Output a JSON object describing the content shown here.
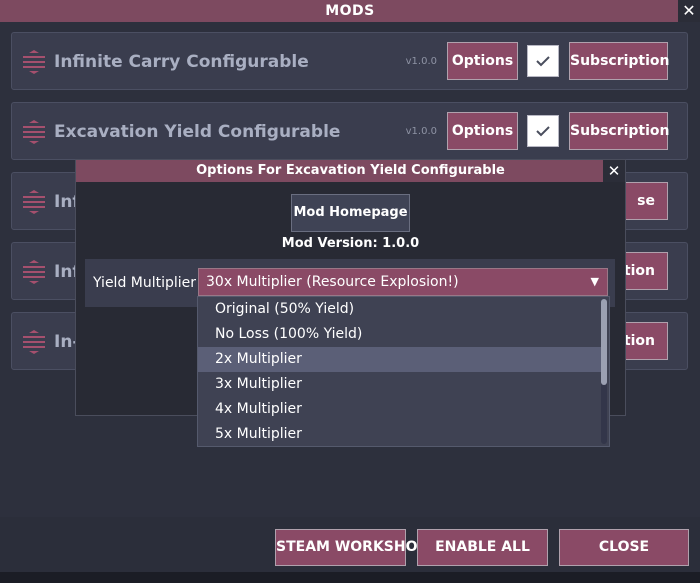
{
  "window": {
    "title": "MODS",
    "close_glyph": "✕"
  },
  "rows": [
    {
      "title": "Infinite Carry Configurable",
      "version": "v1.0.0",
      "options_label": "Options",
      "subscription_label": "Subscription",
      "enabled": true
    },
    {
      "title": "Excavation Yield Configurable",
      "version": "v1.0.0",
      "options_label": "Options",
      "subscription_label": "Subscription",
      "enabled": true
    },
    {
      "title": "Inf",
      "partial_button": "se"
    },
    {
      "title": "Inf",
      "partial_button": "ption"
    },
    {
      "title": "In-",
      "partial_button": "ption"
    }
  ],
  "footer": {
    "steam_label": "STEAM WORKSHOP",
    "enable_label": "ENABLE ALL",
    "close_label": "CLOSE"
  },
  "dialog": {
    "title": "Options For Excavation Yield Configurable",
    "close_glyph": "✕",
    "homepage_label": "Mod Homepage",
    "version_line": "Mod Version: 1.0.0",
    "setting_label": "Yield Multiplier",
    "selected_value": "30x Multiplier (Resource Explosion!)",
    "arrow": "▼",
    "options": [
      "Original (50% Yield)",
      "No Loss (100% Yield)",
      "2x Multiplier",
      "3x Multiplier",
      "4x Multiplier",
      "5x Multiplier"
    ],
    "highlighted_index": 2
  },
  "colors": {
    "accent": "#8a4a66",
    "title_bar": "#7d4a60",
    "row_bg": "#3a3d4e",
    "window_bg": "#2d303d"
  },
  "icons": {
    "drag": "drag-handle-icon",
    "check": "checkmark-icon",
    "close": "close-icon",
    "dropdown": "chevron-down-icon"
  }
}
